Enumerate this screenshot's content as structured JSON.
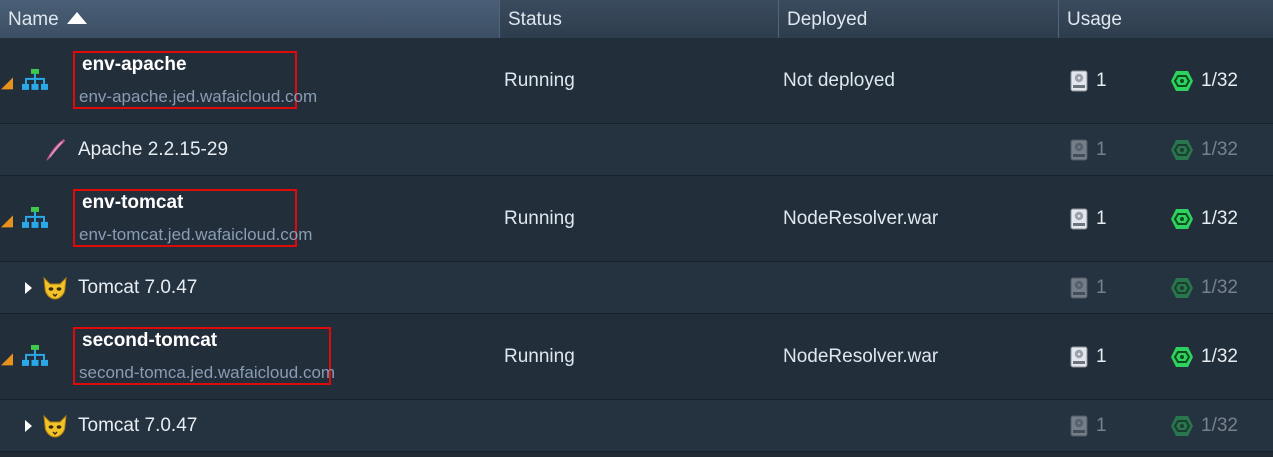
{
  "header": {
    "columns": [
      {
        "key": "name",
        "label": "Name"
      },
      {
        "key": "status",
        "label": "Status"
      },
      {
        "key": "deployed",
        "label": "Deployed"
      },
      {
        "key": "usage",
        "label": "Usage"
      }
    ]
  },
  "rows": [
    {
      "type": "env",
      "name": "env-apache",
      "domain": "env-apache.jed.wafaicloud.com",
      "status": "Running",
      "deployed": "Not deployed",
      "disk": "1",
      "cloudlets": "1/32",
      "icon": "environment-topology-icon"
    },
    {
      "type": "node",
      "name": "Apache 2.2.15-29",
      "disk": "1",
      "cloudlets": "1/32",
      "icon": "apache-feather-icon",
      "expandable": false
    },
    {
      "type": "env",
      "name": "env-tomcat",
      "domain": "env-tomcat.jed.wafaicloud.com",
      "status": "Running",
      "deployed": "NodeResolver.war",
      "disk": "1",
      "cloudlets": "1/32",
      "icon": "environment-topology-icon"
    },
    {
      "type": "node",
      "name": "Tomcat 7.0.47",
      "disk": "1",
      "cloudlets": "1/32",
      "icon": "tomcat-cat-icon",
      "expandable": true
    },
    {
      "type": "env",
      "name": "second-tomcat",
      "domain": "second-tomca.jed.wafaicloud.com",
      "status": "Running",
      "deployed": "NodeResolver.war",
      "disk": "1",
      "cloudlets": "1/32",
      "icon": "environment-topology-icon"
    },
    {
      "type": "node",
      "name": "Tomcat 7.0.47",
      "disk": "1",
      "cloudlets": "1/32",
      "icon": "tomcat-cat-icon",
      "expandable": true
    }
  ],
  "colors": {
    "highlight_box": "#e00a0a",
    "expander_orange": "#e8911c",
    "cloudlet_green": "#2fd15f",
    "topology_blue": "#2aa8e8",
    "topology_green": "#3ec94a"
  }
}
